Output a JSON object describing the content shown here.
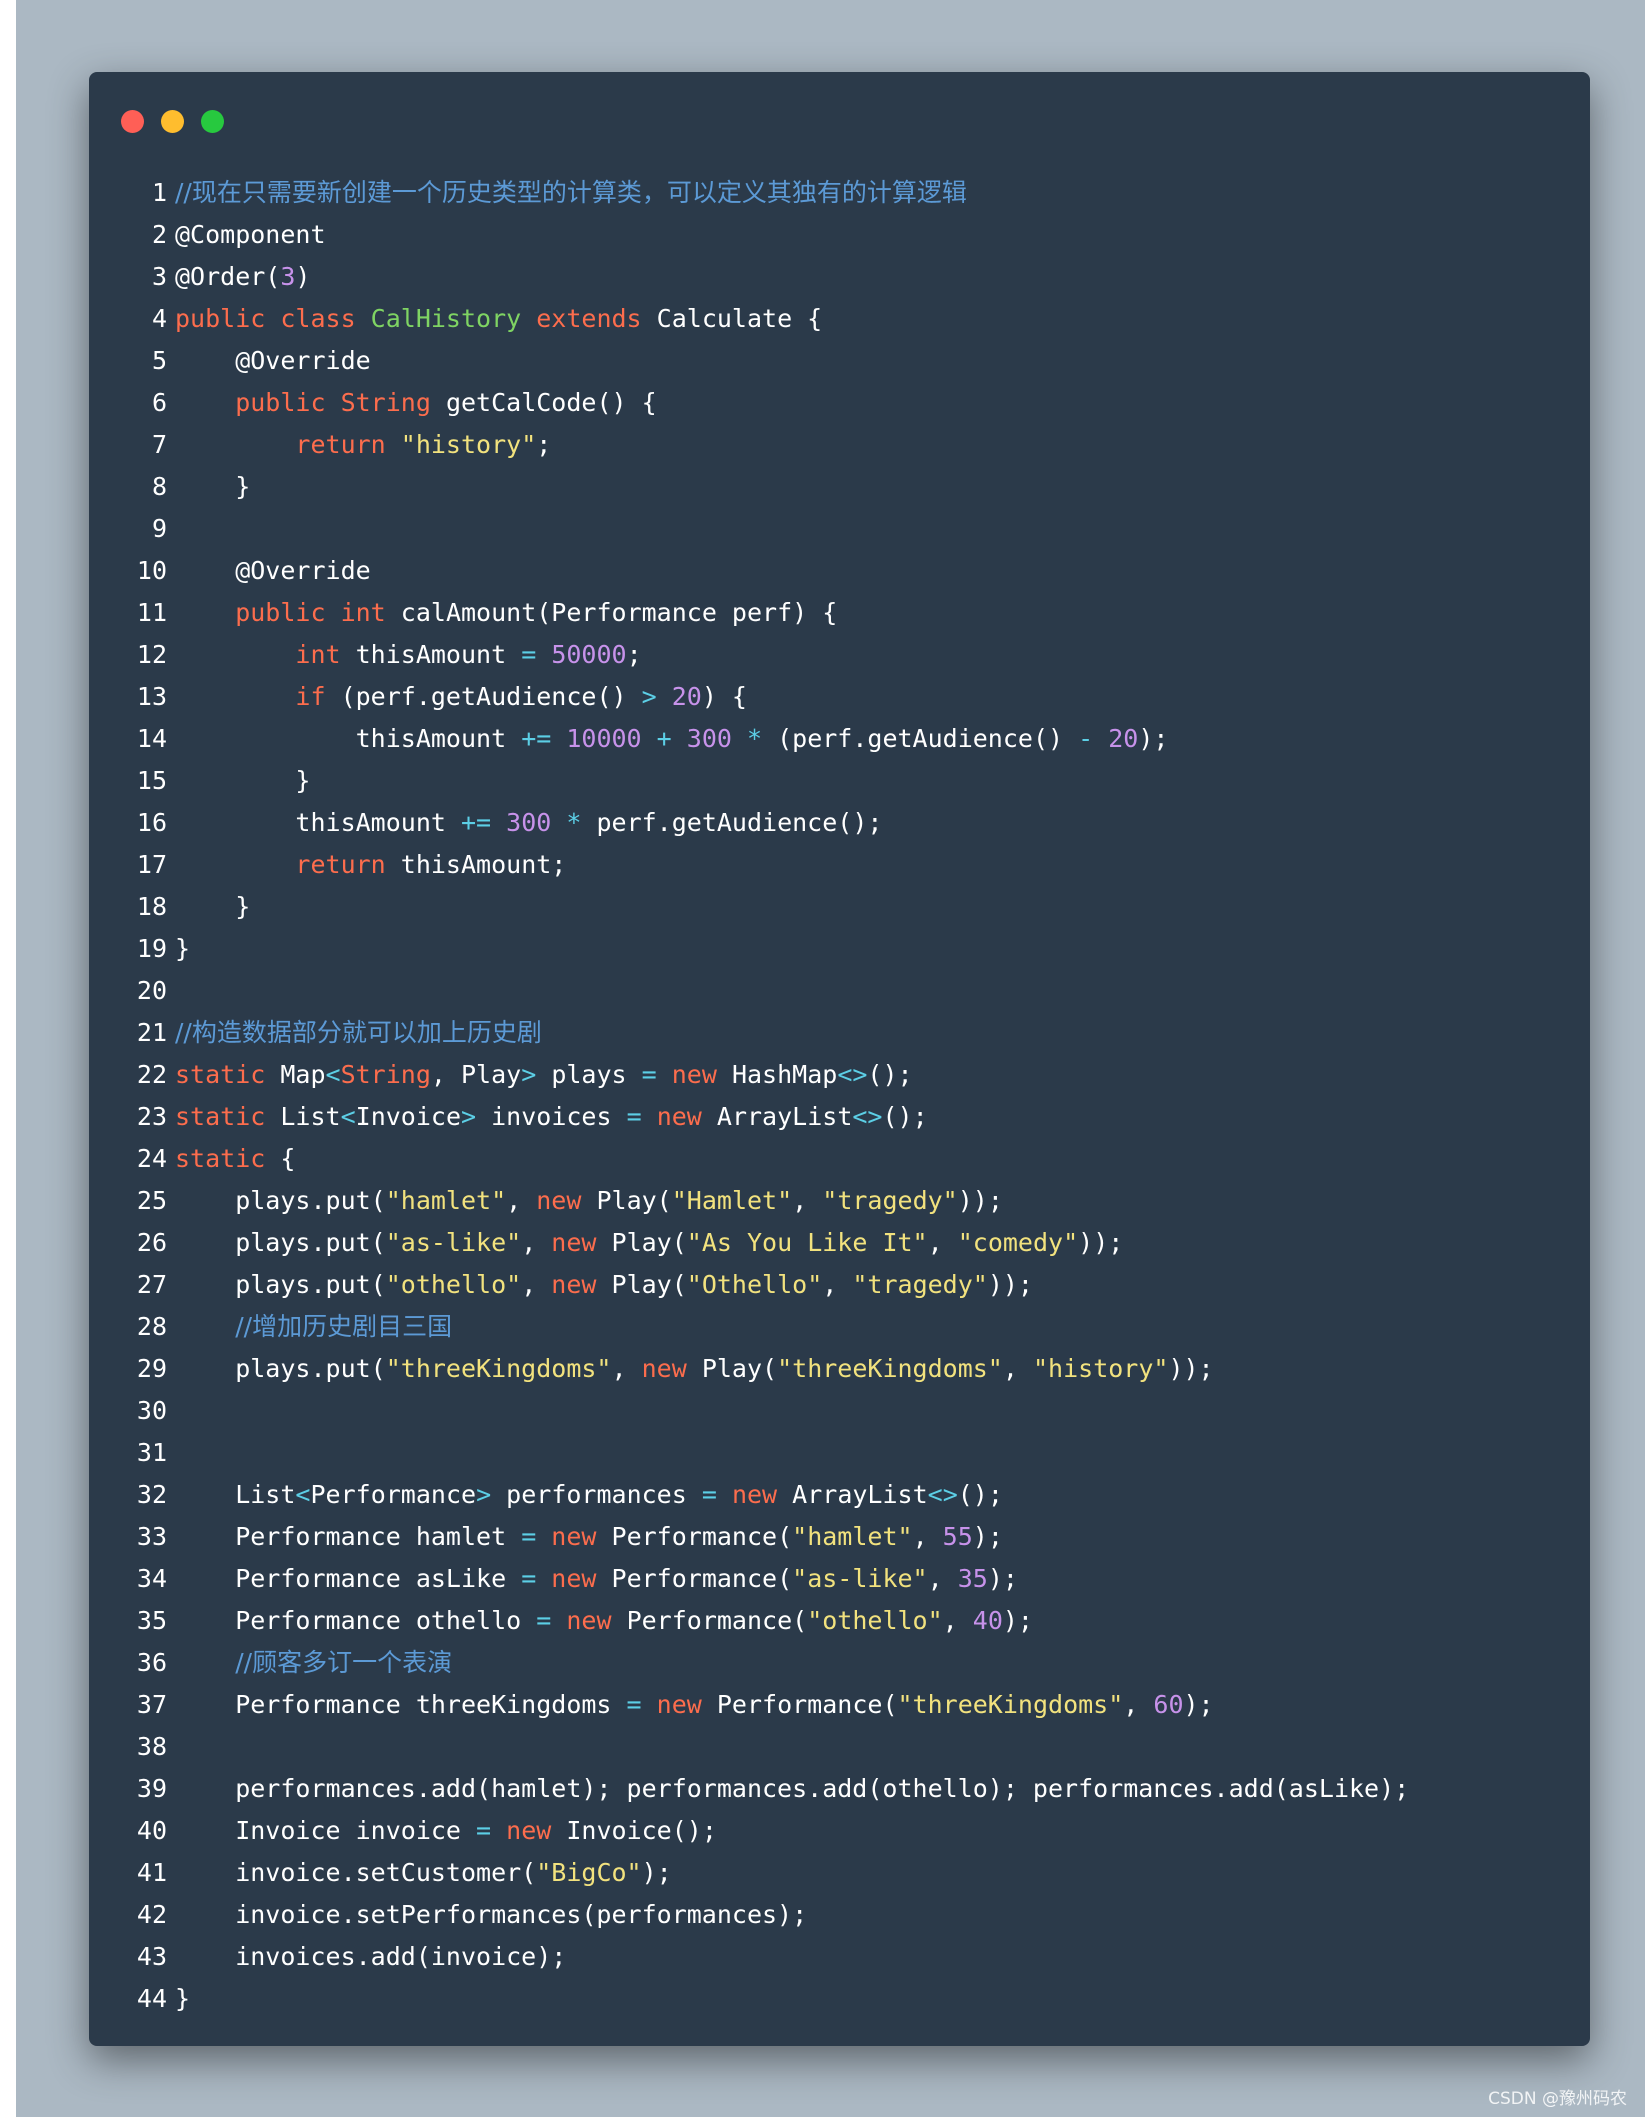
{
  "window": {
    "buttons": [
      {
        "name": "close-dot",
        "color": "#ff5f56"
      },
      {
        "name": "minimize-dot",
        "color": "#ffbd2e"
      },
      {
        "name": "maximize-dot",
        "color": "#27c93f"
      }
    ]
  },
  "colors": {
    "keyword": "#fc6d4d",
    "class": "#7fd463",
    "string": "#f2e27e",
    "number": "#c792ea",
    "operator": "#5ccfe6",
    "comment": "#5c9ad6",
    "plain": "#ffffff",
    "background": "#2b3a4a"
  },
  "code": {
    "lines": [
      [
        [
          "cm",
          "//现在只需要新创建一个历史类型的计算类，可以定义其独有的计算逻辑"
        ]
      ],
      [
        [
          "plain",
          "@Component"
        ]
      ],
      [
        [
          "plain",
          "@Order("
        ],
        [
          "num",
          "3"
        ],
        [
          "plain",
          ")"
        ]
      ],
      [
        [
          "kw",
          "public class "
        ],
        [
          "cls",
          "CalHistory "
        ],
        [
          "kw",
          "extends "
        ],
        [
          "plain",
          "Calculate {"
        ]
      ],
      [
        [
          "plain",
          "    @Override"
        ]
      ],
      [
        [
          "kw",
          "    public "
        ],
        [
          "kw",
          "String "
        ],
        [
          "plain",
          "getCalCode() {"
        ]
      ],
      [
        [
          "kw",
          "        return "
        ],
        [
          "str",
          "\"history\""
        ],
        [
          "plain",
          ";"
        ]
      ],
      [
        [
          "plain",
          "    }"
        ]
      ],
      [
        [
          "plain",
          ""
        ]
      ],
      [
        [
          "plain",
          "    @Override"
        ]
      ],
      [
        [
          "kw",
          "    public "
        ],
        [
          "kw",
          "int "
        ],
        [
          "plain",
          "calAmount(Performance perf) {"
        ]
      ],
      [
        [
          "kw",
          "        int "
        ],
        [
          "plain",
          "thisAmount "
        ],
        [
          "op",
          "= "
        ],
        [
          "num",
          "50000"
        ],
        [
          "plain",
          ";"
        ]
      ],
      [
        [
          "kw",
          "        if "
        ],
        [
          "plain",
          "(perf.getAudience() "
        ],
        [
          "op",
          "> "
        ],
        [
          "num",
          "20"
        ],
        [
          "plain",
          ") {"
        ]
      ],
      [
        [
          "plain",
          "            thisAmount "
        ],
        [
          "op",
          "+= "
        ],
        [
          "num",
          "10000 "
        ],
        [
          "op",
          "+ "
        ],
        [
          "num",
          "300 "
        ],
        [
          "op",
          "* "
        ],
        [
          "plain",
          "(perf.getAudience() "
        ],
        [
          "op",
          "- "
        ],
        [
          "num",
          "20"
        ],
        [
          "plain",
          ");"
        ]
      ],
      [
        [
          "plain",
          "        }"
        ]
      ],
      [
        [
          "plain",
          "        thisAmount "
        ],
        [
          "op",
          "+= "
        ],
        [
          "num",
          "300 "
        ],
        [
          "op",
          "* "
        ],
        [
          "plain",
          "perf.getAudience();"
        ]
      ],
      [
        [
          "kw",
          "        return "
        ],
        [
          "plain",
          "thisAmount;"
        ]
      ],
      [
        [
          "plain",
          "    }"
        ]
      ],
      [
        [
          "plain",
          "}"
        ]
      ],
      [
        [
          "plain",
          ""
        ]
      ],
      [
        [
          "cm",
          "//构造数据部分就可以加上历史剧"
        ]
      ],
      [
        [
          "kw",
          "static "
        ],
        [
          "plain",
          "Map"
        ],
        [
          "op",
          "<"
        ],
        [
          "kw",
          "String"
        ],
        [
          "plain",
          ", Play"
        ],
        [
          "op",
          "> "
        ],
        [
          "plain",
          "plays "
        ],
        [
          "op",
          "= "
        ],
        [
          "kw",
          "new "
        ],
        [
          "plain",
          "HashMap"
        ],
        [
          "op",
          "<>"
        ],
        [
          "plain",
          "();"
        ]
      ],
      [
        [
          "kw",
          "static "
        ],
        [
          "plain",
          "List"
        ],
        [
          "op",
          "<"
        ],
        [
          "plain",
          "Invoice"
        ],
        [
          "op",
          "> "
        ],
        [
          "plain",
          "invoices "
        ],
        [
          "op",
          "= "
        ],
        [
          "kw",
          "new "
        ],
        [
          "plain",
          "ArrayList"
        ],
        [
          "op",
          "<>"
        ],
        [
          "plain",
          "();"
        ]
      ],
      [
        [
          "kw",
          "static "
        ],
        [
          "plain",
          "{"
        ]
      ],
      [
        [
          "plain",
          "    plays.put("
        ],
        [
          "str",
          "\"hamlet\""
        ],
        [
          "plain",
          ", "
        ],
        [
          "kw",
          "new "
        ],
        [
          "plain",
          "Play("
        ],
        [
          "str",
          "\"Hamlet\""
        ],
        [
          "plain",
          ", "
        ],
        [
          "str",
          "\"tragedy\""
        ],
        [
          "plain",
          "));"
        ]
      ],
      [
        [
          "plain",
          "    plays.put("
        ],
        [
          "str",
          "\"as-like\""
        ],
        [
          "plain",
          ", "
        ],
        [
          "kw",
          "new "
        ],
        [
          "plain",
          "Play("
        ],
        [
          "str",
          "\"As You Like It\""
        ],
        [
          "plain",
          ", "
        ],
        [
          "str",
          "\"comedy\""
        ],
        [
          "plain",
          "));"
        ]
      ],
      [
        [
          "plain",
          "    plays.put("
        ],
        [
          "str",
          "\"othello\""
        ],
        [
          "plain",
          ", "
        ],
        [
          "kw",
          "new "
        ],
        [
          "plain",
          "Play("
        ],
        [
          "str",
          "\"Othello\""
        ],
        [
          "plain",
          ", "
        ],
        [
          "str",
          "\"tragedy\""
        ],
        [
          "plain",
          "));"
        ]
      ],
      [
        [
          "plain",
          "    "
        ],
        [
          "cm",
          "//增加历史剧目三国"
        ]
      ],
      [
        [
          "plain",
          "    plays.put("
        ],
        [
          "str",
          "\"threeKingdoms\""
        ],
        [
          "plain",
          ", "
        ],
        [
          "kw",
          "new "
        ],
        [
          "plain",
          "Play("
        ],
        [
          "str",
          "\"threeKingdoms\""
        ],
        [
          "plain",
          ", "
        ],
        [
          "str",
          "\"history\""
        ],
        [
          "plain",
          "));"
        ]
      ],
      [
        [
          "plain",
          ""
        ]
      ],
      [
        [
          "plain",
          ""
        ]
      ],
      [
        [
          "plain",
          "    List"
        ],
        [
          "op",
          "<"
        ],
        [
          "plain",
          "Performance"
        ],
        [
          "op",
          "> "
        ],
        [
          "plain",
          "performances "
        ],
        [
          "op",
          "= "
        ],
        [
          "kw",
          "new "
        ],
        [
          "plain",
          "ArrayList"
        ],
        [
          "op",
          "<>"
        ],
        [
          "plain",
          "();"
        ]
      ],
      [
        [
          "plain",
          "    Performance hamlet "
        ],
        [
          "op",
          "= "
        ],
        [
          "kw",
          "new "
        ],
        [
          "plain",
          "Performance("
        ],
        [
          "str",
          "\"hamlet\""
        ],
        [
          "plain",
          ", "
        ],
        [
          "num",
          "55"
        ],
        [
          "plain",
          ");"
        ]
      ],
      [
        [
          "plain",
          "    Performance asLike "
        ],
        [
          "op",
          "= "
        ],
        [
          "kw",
          "new "
        ],
        [
          "plain",
          "Performance("
        ],
        [
          "str",
          "\"as-like\""
        ],
        [
          "plain",
          ", "
        ],
        [
          "num",
          "35"
        ],
        [
          "plain",
          ");"
        ]
      ],
      [
        [
          "plain",
          "    Performance othello "
        ],
        [
          "op",
          "= "
        ],
        [
          "kw",
          "new "
        ],
        [
          "plain",
          "Performance("
        ],
        [
          "str",
          "\"othello\""
        ],
        [
          "plain",
          ", "
        ],
        [
          "num",
          "40"
        ],
        [
          "plain",
          ");"
        ]
      ],
      [
        [
          "plain",
          "    "
        ],
        [
          "cm",
          "//顾客多订一个表演"
        ]
      ],
      [
        [
          "plain",
          "    Performance threeKingdoms "
        ],
        [
          "op",
          "= "
        ],
        [
          "kw",
          "new "
        ],
        [
          "plain",
          "Performance("
        ],
        [
          "str",
          "\"threeKingdoms\""
        ],
        [
          "plain",
          ", "
        ],
        [
          "num",
          "60"
        ],
        [
          "plain",
          ");"
        ]
      ],
      [
        [
          "plain",
          ""
        ]
      ],
      [
        [
          "plain",
          "    performances.add(hamlet); performances.add(othello); performances.add(asLike);"
        ]
      ],
      [
        [
          "plain",
          "    Invoice invoice "
        ],
        [
          "op",
          "= "
        ],
        [
          "kw",
          "new "
        ],
        [
          "plain",
          "Invoice();"
        ]
      ],
      [
        [
          "plain",
          "    invoice.setCustomer("
        ],
        [
          "str",
          "\"BigCo\""
        ],
        [
          "plain",
          ");"
        ]
      ],
      [
        [
          "plain",
          "    invoice.setPerformances(performances);"
        ]
      ],
      [
        [
          "plain",
          "    invoices.add(invoice);"
        ]
      ],
      [
        [
          "plain",
          "}"
        ]
      ]
    ]
  },
  "watermark": "CSDN @豫州码农"
}
